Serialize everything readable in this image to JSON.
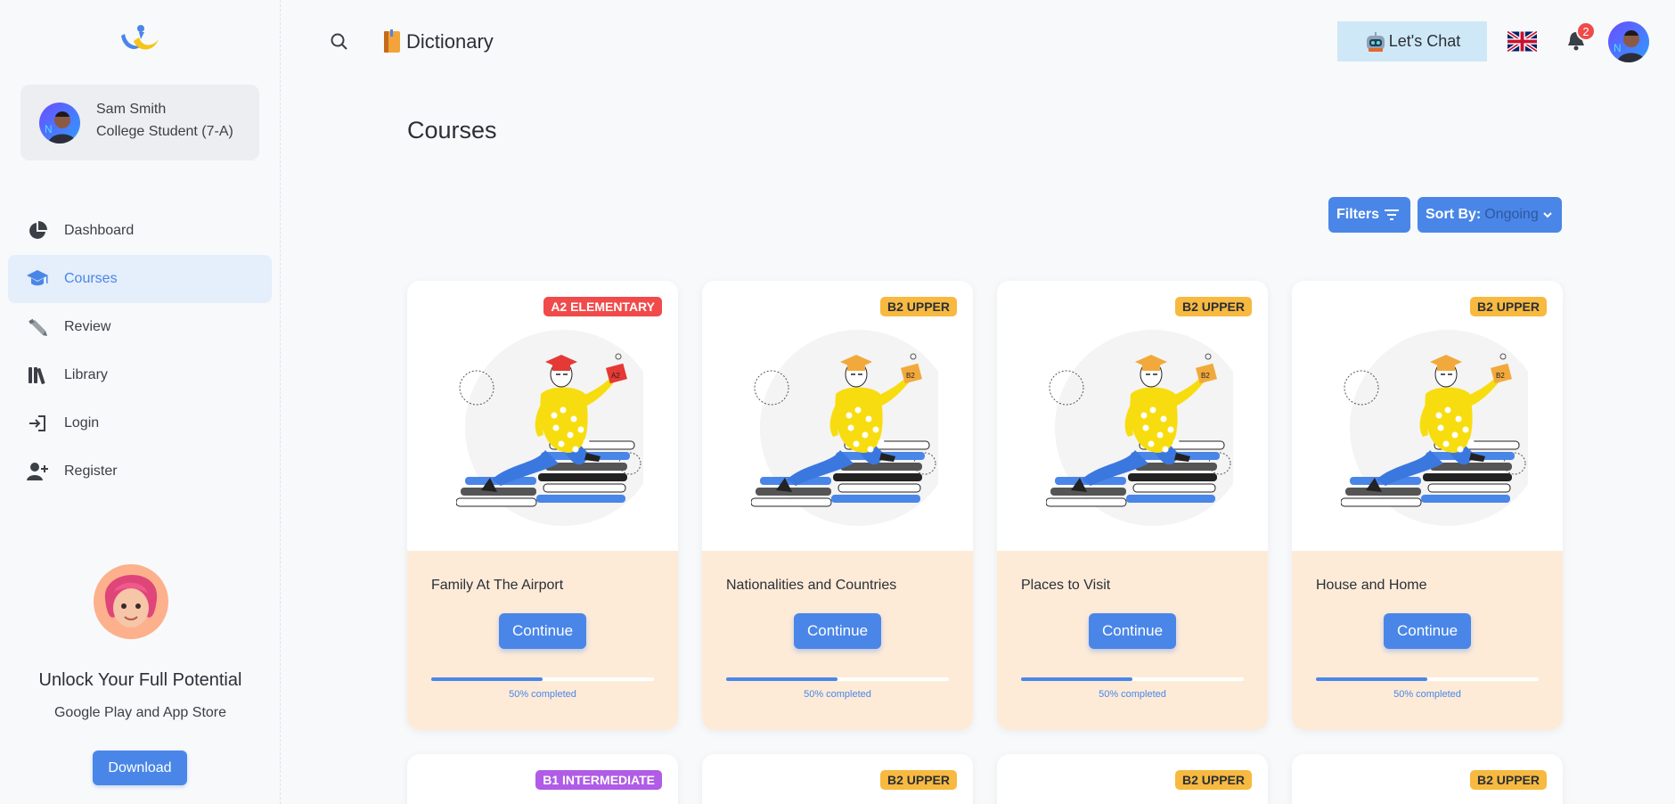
{
  "user": {
    "name": "Sam Smith",
    "role": "College Student (7-A)"
  },
  "nav": [
    {
      "id": "dashboard",
      "label": "Dashboard",
      "icon": "pie-chart-icon",
      "active": false
    },
    {
      "id": "courses",
      "label": "Courses",
      "icon": "graduation-cap-icon",
      "active": true
    },
    {
      "id": "review",
      "label": "Review",
      "icon": "pen-icon",
      "active": false
    },
    {
      "id": "library",
      "label": "Library",
      "icon": "books-icon",
      "active": false
    },
    {
      "id": "login",
      "label": "Login",
      "icon": "login-icon",
      "active": false
    },
    {
      "id": "register",
      "label": "Register",
      "icon": "add-user-icon",
      "active": false
    }
  ],
  "promo": {
    "title": "Unlock Your Full Potential",
    "subtitle": "Google Play and App Store",
    "button": "Download"
  },
  "header": {
    "dictionary": "Dictionary",
    "chat": "Let's Chat",
    "notifications": "2"
  },
  "page": {
    "title": "Courses",
    "filters": "Filters",
    "sort_label": "Sort By:",
    "sort_value": "Ongoing"
  },
  "courses": [
    {
      "title": "Family At The Airport",
      "level": "A2 ELEMENTARY",
      "level_color": "#f04a4a",
      "level_text": "#ffffff",
      "cap_color": "#e53935",
      "action": "Continue",
      "progress": 0.5,
      "progress_text": "50% completed",
      "book_label": "A2"
    },
    {
      "title": "Nationalities and Countries",
      "level": "B2 UPPER",
      "level_color": "#f7b940",
      "level_text": "#2b2f36",
      "cap_color": "#f2a93b",
      "action": "Continue",
      "progress": 0.5,
      "progress_text": "50% completed",
      "book_label": "B2"
    },
    {
      "title": "Places to Visit",
      "level": "B2 UPPER",
      "level_color": "#f7b940",
      "level_text": "#2b2f36",
      "cap_color": "#f2a93b",
      "action": "Continue",
      "progress": 0.5,
      "progress_text": "50% completed",
      "book_label": "B2"
    },
    {
      "title": "House and Home",
      "level": "B2 UPPER",
      "level_color": "#f7b940",
      "level_text": "#2b2f36",
      "cap_color": "#f2a93b",
      "action": "Continue",
      "progress": 0.5,
      "progress_text": "50% completed",
      "book_label": "B2"
    }
  ],
  "courses_row2": [
    {
      "level": "B1 INTERMEDIATE",
      "level_color": "#b05ce6",
      "level_text": "#ffffff"
    },
    {
      "level": "B2 UPPER",
      "level_color": "#f7b940",
      "level_text": "#2b2f36"
    },
    {
      "level": "B2 UPPER",
      "level_color": "#f7b940",
      "level_text": "#2b2f36"
    },
    {
      "level": "B2 UPPER",
      "level_color": "#f7b940",
      "level_text": "#2b2f36"
    }
  ]
}
